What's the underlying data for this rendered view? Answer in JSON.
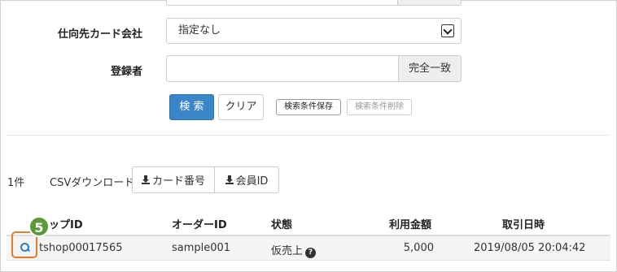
{
  "form": {
    "card_company_label": "仕向先カード会社",
    "card_company_value": "指定なし",
    "registrant_label": "登録者",
    "registrant_value": "",
    "match_label": "完全一致",
    "search_button": "検 索",
    "clear_button": "クリア",
    "save_conditions_button": "検索条件保存",
    "delete_conditions_button": "検索条件削除"
  },
  "results": {
    "count": "1件",
    "csv_label": "CSVダウンロード",
    "csv_card_number": "カード番号",
    "csv_member_id": "会員ID"
  },
  "table": {
    "headers": {
      "shop_id": "ップID",
      "order_id": "オーダーID",
      "status": "状態",
      "amount": "利用金額",
      "datetime": "取引日時"
    },
    "rows": [
      {
        "shop_id": "tshop00017565",
        "order_id": "sample001",
        "status": "仮売上",
        "amount": "5,000",
        "datetime": "2019/08/05 20:04:42"
      }
    ]
  },
  "annotation": {
    "step_number": "5",
    "highlight_color": "#ea7a2a",
    "badge_color": "#5a9a3a"
  },
  "icons": {
    "detail": "zoom-in-icon",
    "help": "question-circle-icon",
    "download": "download-icon",
    "dropdown": "chevron-down-icon"
  }
}
